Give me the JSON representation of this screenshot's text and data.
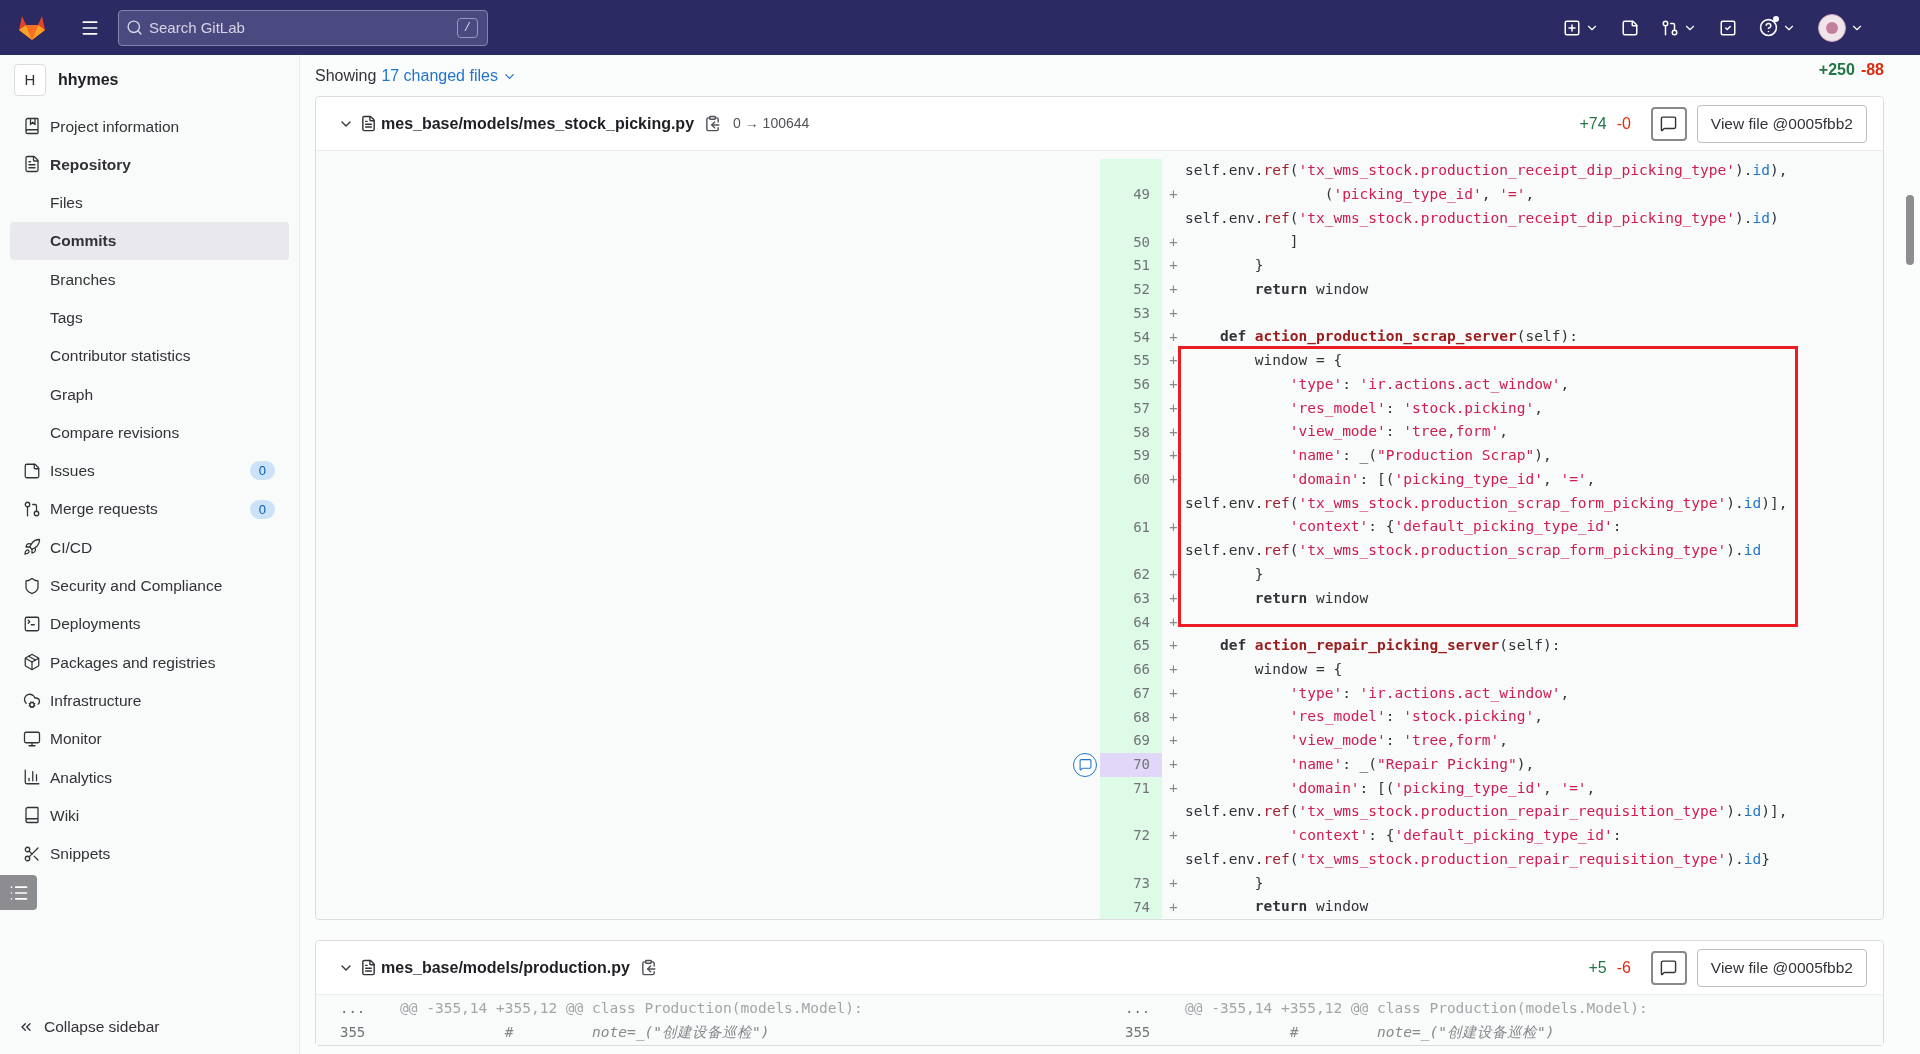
{
  "topbar": {
    "search": {
      "placeholder": "Search GitLab",
      "shortcut": "/"
    }
  },
  "sidebar": {
    "project": {
      "initial": "H",
      "name": "hhymes"
    },
    "items": [
      {
        "label": "Project information",
        "selected": false,
        "expanded": false
      },
      {
        "label": "Repository",
        "selected": false,
        "expanded": true,
        "children": [
          {
            "label": "Files",
            "selected": false
          },
          {
            "label": "Commits",
            "selected": true
          },
          {
            "label": "Branches",
            "selected": false
          },
          {
            "label": "Tags",
            "selected": false
          },
          {
            "label": "Contributor statistics",
            "selected": false
          },
          {
            "label": "Graph",
            "selected": false
          },
          {
            "label": "Compare revisions",
            "selected": false
          }
        ]
      },
      {
        "label": "Issues",
        "selected": false,
        "expanded": false,
        "count": "0"
      },
      {
        "label": "Merge requests",
        "selected": false,
        "expanded": false,
        "count": "0"
      },
      {
        "label": "CI/CD",
        "selected": false,
        "expanded": false
      },
      {
        "label": "Security and Compliance",
        "selected": false,
        "expanded": false
      },
      {
        "label": "Deployments",
        "selected": false,
        "expanded": false
      },
      {
        "label": "Packages and registries",
        "selected": false,
        "expanded": false
      },
      {
        "label": "Infrastructure",
        "selected": false,
        "expanded": false
      },
      {
        "label": "Monitor",
        "selected": false,
        "expanded": false
      },
      {
        "label": "Analytics",
        "selected": false,
        "expanded": false
      },
      {
        "label": "Wiki",
        "selected": false,
        "expanded": false
      },
      {
        "label": "Snippets",
        "selected": false,
        "expanded": false
      }
    ],
    "collapse": "Collapse sidebar"
  },
  "summary": {
    "prefix": "Showing",
    "link": "17 changed files",
    "added": "+250",
    "removed": "-88"
  },
  "files": [
    {
      "path": "mes_base/models/mes_stock_picking.py",
      "mode": "0 → 100644",
      "added": "+74",
      "removed": "-0",
      "view_button": "View file @0005fbb2",
      "kind": "inline",
      "rows": [
        {
          "highlighted": false,
          "tokens": [
            {
              "kind": "plain",
              "text": "self.env."
            },
            {
              "kind": "ref",
              "text": "ref"
            },
            {
              "kind": "plain",
              "text": "("
            },
            {
              "kind": "string",
              "text": "'tx_wms_stock.production_receipt_dip_picking_type'"
            },
            {
              "kind": "plain",
              "text": ")."
            },
            {
              "kind": "attr",
              "text": "id"
            },
            {
              "kind": "plain",
              "text": "),"
            }
          ]
        },
        {
          "number": "49",
          "sign": "+",
          "highlighted": false,
          "tokens": [
            {
              "kind": "plain",
              "text": "                ("
            },
            {
              "kind": "string",
              "text": "'picking_type_id'"
            },
            {
              "kind": "plain",
              "text": ", "
            },
            {
              "kind": "string",
              "text": "'='"
            },
            {
              "kind": "plain",
              "text": ","
            }
          ]
        },
        {
          "highlighted": false,
          "tokens": [
            {
              "kind": "plain",
              "text": "self.env."
            },
            {
              "kind": "ref",
              "text": "ref"
            },
            {
              "kind": "plain",
              "text": "("
            },
            {
              "kind": "string",
              "text": "'tx_wms_stock.production_receipt_dip_picking_type'"
            },
            {
              "kind": "plain",
              "text": ")."
            },
            {
              "kind": "attr",
              "text": "id"
            },
            {
              "kind": "plain",
              "text": ")"
            }
          ]
        },
        {
          "number": "50",
          "sign": "+",
          "highlighted": false,
          "tokens": [
            {
              "kind": "plain",
              "text": "            ]"
            }
          ]
        },
        {
          "number": "51",
          "sign": "+",
          "highlighted": false,
          "tokens": [
            {
              "kind": "plain",
              "text": "        }"
            }
          ]
        },
        {
          "number": "52",
          "sign": "+",
          "highlighted": false,
          "tokens": [
            {
              "kind": "keyword",
              "text": "        return"
            },
            {
              "kind": "plain",
              "text": " window"
            }
          ]
        },
        {
          "number": "53",
          "sign": "+",
          "highlighted": false,
          "tokens": []
        },
        {
          "number": "54",
          "sign": "+",
          "highlighted": false,
          "tokens": [
            {
              "kind": "keyword",
              "text": "    def "
            },
            {
              "kind": "function",
              "text": "action_production_scrap_server"
            },
            {
              "kind": "plain",
              "text": "(self):"
            }
          ]
        },
        {
          "number": "55",
          "sign": "+",
          "highlighted": false,
          "tokens": [
            {
              "kind": "plain",
              "text": "        window = {"
            }
          ]
        },
        {
          "number": "56",
          "sign": "+",
          "highlighted": false,
          "tokens": [
            {
              "kind": "string",
              "text": "            'type'"
            },
            {
              "kind": "plain",
              "text": ": "
            },
            {
              "kind": "string",
              "text": "'ir.actions.act_window'"
            },
            {
              "kind": "plain",
              "text": ","
            }
          ]
        },
        {
          "number": "57",
          "sign": "+",
          "highlighted": false,
          "tokens": [
            {
              "kind": "string",
              "text": "            'res_model'"
            },
            {
              "kind": "plain",
              "text": ": "
            },
            {
              "kind": "string",
              "text": "'stock.picking'"
            },
            {
              "kind": "plain",
              "text": ","
            }
          ]
        },
        {
          "number": "58",
          "sign": "+",
          "highlighted": false,
          "tokens": [
            {
              "kind": "string",
              "text": "            'view_mode'"
            },
            {
              "kind": "plain",
              "text": ": "
            },
            {
              "kind": "string",
              "text": "'tree,form'"
            },
            {
              "kind": "plain",
              "text": ","
            }
          ]
        },
        {
          "number": "59",
          "sign": "+",
          "highlighted": false,
          "tokens": [
            {
              "kind": "string",
              "text": "            'name'"
            },
            {
              "kind": "plain",
              "text": ": _("
            },
            {
              "kind": "string",
              "text": "\"Production Scrap\""
            },
            {
              "kind": "plain",
              "text": "),"
            }
          ]
        },
        {
          "number": "60",
          "sign": "+",
          "highlighted": false,
          "tokens": [
            {
              "kind": "string",
              "text": "            'domain'"
            },
            {
              "kind": "plain",
              "text": ": [("
            },
            {
              "kind": "string",
              "text": "'picking_type_id'"
            },
            {
              "kind": "plain",
              "text": ", "
            },
            {
              "kind": "string",
              "text": "'='"
            },
            {
              "kind": "plain",
              "text": ","
            }
          ]
        },
        {
          "highlighted": false,
          "tokens": [
            {
              "kind": "plain",
              "text": "self.env."
            },
            {
              "kind": "ref",
              "text": "ref"
            },
            {
              "kind": "plain",
              "text": "("
            },
            {
              "kind": "string",
              "text": "'tx_wms_stock.production_scrap_form_picking_type'"
            },
            {
              "kind": "plain",
              "text": ")."
            },
            {
              "kind": "attr",
              "text": "id"
            },
            {
              "kind": "plain",
              "text": ")],"
            }
          ]
        },
        {
          "number": "61",
          "sign": "+",
          "highlighted": false,
          "tokens": [
            {
              "kind": "string",
              "text": "            'context'"
            },
            {
              "kind": "plain",
              "text": ": {"
            },
            {
              "kind": "string",
              "text": "'default_picking_type_id'"
            },
            {
              "kind": "plain",
              "text": ":"
            }
          ]
        },
        {
          "highlighted": false,
          "tokens": [
            {
              "kind": "plain",
              "text": "self.env."
            },
            {
              "kind": "ref",
              "text": "ref"
            },
            {
              "kind": "plain",
              "text": "("
            },
            {
              "kind": "string",
              "text": "'tx_wms_stock.production_scrap_form_picking_type'"
            },
            {
              "kind": "plain",
              "text": ")."
            },
            {
              "kind": "attr",
              "text": "id"
            }
          ]
        },
        {
          "number": "62",
          "sign": "+",
          "highlighted": false,
          "tokens": [
            {
              "kind": "plain",
              "text": "        }"
            }
          ]
        },
        {
          "number": "63",
          "sign": "+",
          "highlighted": false,
          "tokens": [
            {
              "kind": "keyword",
              "text": "        return"
            },
            {
              "kind": "plain",
              "text": " window"
            }
          ]
        },
        {
          "number": "64",
          "sign": "+",
          "highlighted": false,
          "tokens": []
        },
        {
          "number": "65",
          "sign": "+",
          "highlighted": false,
          "tokens": [
            {
              "kind": "keyword",
              "text": "    def "
            },
            {
              "kind": "function",
              "text": "action_repair_picking_server"
            },
            {
              "kind": "plain",
              "text": "(self):"
            }
          ]
        },
        {
          "number": "66",
          "sign": "+",
          "highlighted": false,
          "tokens": [
            {
              "kind": "plain",
              "text": "        window = {"
            }
          ]
        },
        {
          "number": "67",
          "sign": "+",
          "highlighted": false,
          "tokens": [
            {
              "kind": "string",
              "text": "            'type'"
            },
            {
              "kind": "plain",
              "text": ": "
            },
            {
              "kind": "string",
              "text": "'ir.actions.act_window'"
            },
            {
              "kind": "plain",
              "text": ","
            }
          ]
        },
        {
          "number": "68",
          "sign": "+",
          "highlighted": false,
          "tokens": [
            {
              "kind": "string",
              "text": "            'res_model'"
            },
            {
              "kind": "plain",
              "text": ": "
            },
            {
              "kind": "string",
              "text": "'stock.picking'"
            },
            {
              "kind": "plain",
              "text": ","
            }
          ]
        },
        {
          "number": "69",
          "sign": "+",
          "highlighted": false,
          "tokens": [
            {
              "kind": "string",
              "text": "            'view_mode'"
            },
            {
              "kind": "plain",
              "text": ": "
            },
            {
              "kind": "string",
              "text": "'tree,form'"
            },
            {
              "kind": "plain",
              "text": ","
            }
          ]
        },
        {
          "number": "70",
          "sign": "+",
          "highlighted": true,
          "tokens": [
            {
              "kind": "string",
              "text": "            'name'"
            },
            {
              "kind": "plain",
              "text": ": _("
            },
            {
              "kind": "string",
              "text": "\"Repair Picking\""
            },
            {
              "kind": "plain",
              "text": "),"
            }
          ]
        },
        {
          "number": "71",
          "sign": "+",
          "highlighted": false,
          "tokens": [
            {
              "kind": "string",
              "text": "            'domain'"
            },
            {
              "kind": "plain",
              "text": ": [("
            },
            {
              "kind": "string",
              "text": "'picking_type_id'"
            },
            {
              "kind": "plain",
              "text": ", "
            },
            {
              "kind": "string",
              "text": "'='"
            },
            {
              "kind": "plain",
              "text": ","
            }
          ]
        },
        {
          "highlighted": false,
          "tokens": [
            {
              "kind": "plain",
              "text": "self.env."
            },
            {
              "kind": "ref",
              "text": "ref"
            },
            {
              "kind": "plain",
              "text": "("
            },
            {
              "kind": "string",
              "text": "'tx_wms_stock.production_repair_requisition_type'"
            },
            {
              "kind": "plain",
              "text": ")."
            },
            {
              "kind": "attr",
              "text": "id"
            },
            {
              "kind": "plain",
              "text": ")],"
            }
          ]
        },
        {
          "number": "72",
          "sign": "+",
          "highlighted": false,
          "tokens": [
            {
              "kind": "string",
              "text": "            'context'"
            },
            {
              "kind": "plain",
              "text": ": {"
            },
            {
              "kind": "string",
              "text": "'default_picking_type_id'"
            },
            {
              "kind": "plain",
              "text": ":"
            }
          ]
        },
        {
          "highlighted": false,
          "tokens": [
            {
              "kind": "plain",
              "text": "self.env."
            },
            {
              "kind": "ref",
              "text": "ref"
            },
            {
              "kind": "plain",
              "text": "("
            },
            {
              "kind": "string",
              "text": "'tx_wms_stock.production_repair_requisition_type'"
            },
            {
              "kind": "plain",
              "text": ")."
            },
            {
              "kind": "attr",
              "text": "id"
            },
            {
              "kind": "plain",
              "text": "}"
            }
          ]
        },
        {
          "number": "73",
          "sign": "+",
          "highlighted": false,
          "tokens": [
            {
              "kind": "plain",
              "text": "        }"
            }
          ]
        },
        {
          "number": "74",
          "sign": "+",
          "highlighted": false,
          "tokens": [
            {
              "kind": "keyword",
              "text": "        return"
            },
            {
              "kind": "plain",
              "text": " window"
            }
          ]
        }
      ]
    },
    {
      "path": "mes_base/models/production.py",
      "added": "+5",
      "removed": "-6",
      "view_button": "View file @0005fbb2",
      "kind": "parallel",
      "rows": [
        {
          "left": {
            "number": "...",
            "tokens": [
              {
                "kind": "meta",
                "text": "@@ -355,14 +355,12 @@ class Production(models.Model):"
              }
            ]
          },
          "right": {
            "number": "...",
            "tokens": [
              {
                "kind": "meta",
                "text": "@@ -355,14 +355,12 @@ class Production(models.Model):"
              }
            ]
          }
        },
        {
          "left": {
            "number": "355",
            "tokens": [
              {
                "kind": "comment",
                "text": "            #         "
              },
              {
                "kind": "doc",
                "text": "note=_(\"创建设备巡检\")"
              }
            ]
          },
          "right": {
            "number": "355",
            "tokens": [
              {
                "kind": "comment",
                "text": "            #         "
              },
              {
                "kind": "doc",
                "text": "note=_(\"创建设备巡检\")"
              }
            ]
          }
        }
      ]
    }
  ]
}
